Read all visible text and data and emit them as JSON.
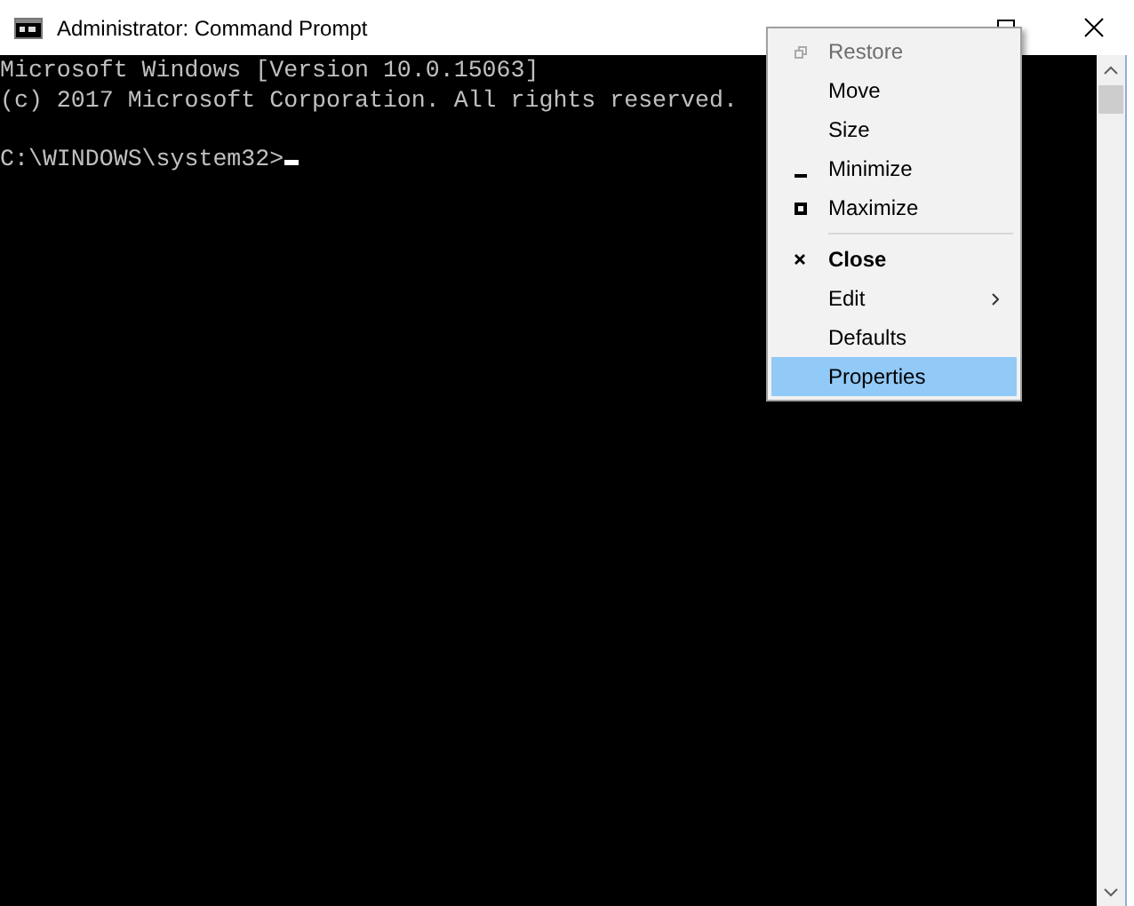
{
  "window": {
    "title": "Administrator: Command Prompt"
  },
  "console": {
    "lines": [
      "Microsoft Windows [Version 10.0.15063]",
      "(c) 2017 Microsoft Corporation. All rights reserved."
    ],
    "prompt": "C:\\WINDOWS\\system32>"
  },
  "system_menu": {
    "groups": [
      [
        {
          "label": "Restore",
          "kind": "restore",
          "disabled": true,
          "bold": false,
          "submenu": false,
          "selected": false
        },
        {
          "label": "Move",
          "kind": "plain",
          "disabled": false,
          "bold": false,
          "submenu": false,
          "selected": false
        },
        {
          "label": "Size",
          "kind": "plain",
          "disabled": false,
          "bold": false,
          "submenu": false,
          "selected": false
        },
        {
          "label": "Minimize",
          "kind": "minimize",
          "disabled": false,
          "bold": false,
          "submenu": false,
          "selected": false
        },
        {
          "label": "Maximize",
          "kind": "maximize",
          "disabled": false,
          "bold": false,
          "submenu": false,
          "selected": false
        }
      ],
      [
        {
          "label": "Close",
          "kind": "close",
          "disabled": false,
          "bold": true,
          "submenu": false,
          "selected": false
        },
        {
          "label": "Edit",
          "kind": "plain",
          "disabled": false,
          "bold": false,
          "submenu": true,
          "selected": false
        },
        {
          "label": "Defaults",
          "kind": "plain",
          "disabled": false,
          "bold": false,
          "submenu": false,
          "selected": false
        },
        {
          "label": "Properties",
          "kind": "plain",
          "disabled": false,
          "bold": false,
          "submenu": false,
          "selected": true
        }
      ]
    ]
  }
}
